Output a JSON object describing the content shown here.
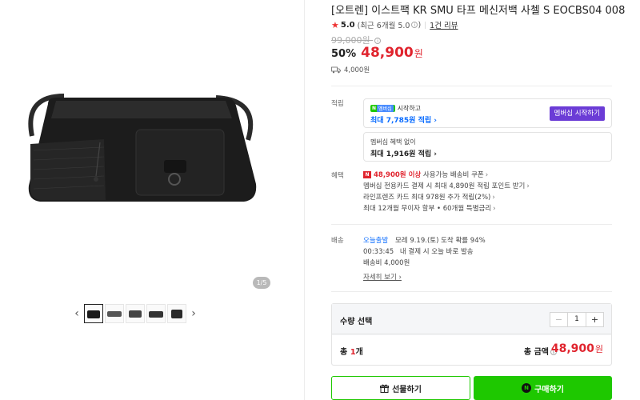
{
  "product": {
    "title": "[오트렌] 이스트팩 KR SMU 타프 메신저백 사첼 S EOCBS04 008",
    "rating": "5.0",
    "rating_note": "(최근 6개월 5.0",
    "rating_note_close": ")",
    "review_link": "1건 리뷰",
    "original_price": "99,000원",
    "discount": "50%",
    "sale_price": "48,900",
    "currency": "원",
    "shipping_fee": "4,000원",
    "image_counter": "1/5"
  },
  "thumbnails": {
    "prev": "‹",
    "next": "›"
  },
  "points": {
    "label": "적립",
    "npay_badge": "N",
    "npay_plus": "멤버십",
    "npay_text": "시작하고",
    "max_with_membership": "최대 7,785원 적립 ›",
    "member_button": "멤버십 시작하기",
    "no_membership": "멤버십 혜택 없이",
    "max_without": "최대 1,916원 적립 ›"
  },
  "benefits": {
    "label": "혜택",
    "badge": "N",
    "line1_red": "48,900원 이상",
    "line1_rest": " 사용가능 배송비 쿠폰",
    "line2": "멤버십 전용카드 결제 시 최대 4,890원 적립 포인트 받기",
    "line3": "라인프렌즈 카드 최대 978원 추가 적립(2%)",
    "line4": "최대 12개월 무이자 할부 • 60개월 특별금리",
    "chevron": "›"
  },
  "delivery": {
    "label": "배송",
    "type": "오늘출발",
    "eta": "모레 9.19.(토) 도착 확률 94%",
    "countdown": "00:33:45",
    "countdown_note": "내 결제 시 오늘 바로 발송",
    "fee": "배송비 4,000원",
    "detail_link": "자세히 보기 ›"
  },
  "quantity": {
    "label": "수량 선택",
    "minus": "−",
    "value": "1",
    "plus": "+",
    "total_count_prefix": "총 ",
    "total_count_num": "1",
    "total_count_suffix": "개",
    "total_amount_label": "총 금액",
    "total_amount": "48,900",
    "currency": "원"
  },
  "actions": {
    "gift": "선물하기",
    "buy": "구매하기",
    "buy_icon": "N"
  },
  "colors": {
    "accent_red": "#e0242e",
    "naver_green": "#1ec800",
    "member_purple": "#6b3cd6",
    "link_blue": "#0a6cff"
  }
}
